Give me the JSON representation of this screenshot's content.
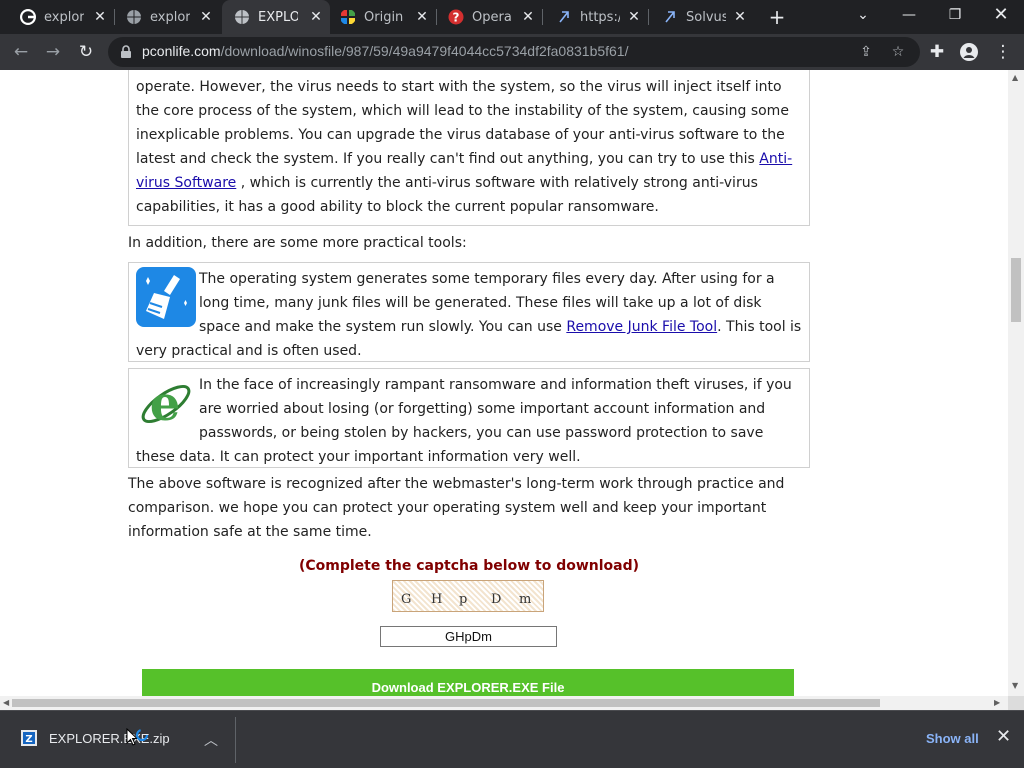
{
  "browser": {
    "tabs": [
      {
        "title": "explorer",
        "favicon": "google-icon",
        "active": false
      },
      {
        "title": "explorer",
        "favicon": "globe-icon",
        "active": false
      },
      {
        "title": "EXPLOR",
        "favicon": "globe-icon",
        "active": true
      },
      {
        "title": "Original",
        "favicon": "colorful-grid-icon",
        "active": false
      },
      {
        "title": "Operati",
        "favicon": "question-icon",
        "active": false
      },
      {
        "title": "https://",
        "favicon": "link-icon",
        "active": false
      },
      {
        "title": "Solvuso",
        "favicon": "link-icon",
        "active": false
      }
    ],
    "url_host": "pconlife.com",
    "url_path": "/download/winosfile/987/59/49a9479f4044cc5734df2fa0831b5f61/"
  },
  "page": {
    "box1_text_before_link": "operate. However, the virus needs to start with the system, so the virus will inject itself into the core process of the system, which will lead to the instability of the system, causing some inexplicable problems. You can upgrade the virus database of your anti-virus software to the latest and check the system. If you really can't find out anything, you can try to use this ",
    "box1_link": "Anti-virus Software",
    "box1_text_after_link": " , which is currently the anti-virus software with relatively strong anti-virus capabilities, it has a good ability to block the current popular ransomware.",
    "addition_text": "In addition, there are some more practical tools:",
    "box2_text_before_link": "The operating system generates some temporary files every day. After using for a long time, many junk files will be generated. These files will take up a lot of disk space and make the system run slowly. You can use ",
    "box2_link": "Remove Junk File Tool",
    "box2_text_after_link": ". This tool is very practical and is often used.",
    "box3_text": "In the face of increasingly rampant ransomware and information theft viruses, if you are worried about losing (or forgetting) some important account information and passwords, or being stolen by hackers, you can use password protection to save these data. It can protect your important information very well.",
    "summary_text": "The above software is recognized after the webmaster's long-term work through practice and comparison. we hope you can protect your operating system well and keep your important information safe at the same time.",
    "captcha_prompt": "(Complete the captcha below to download)",
    "captcha_chars": [
      "G",
      "H",
      "p",
      "D",
      "m"
    ],
    "captcha_value": "GHpDm",
    "download_button": "Download EXPLORER.EXE File"
  },
  "downloads": {
    "file_name": "EXPLORER.EXE.zip",
    "show_all": "Show all"
  },
  "colors": {
    "accent_link": "#1a0dab",
    "captcha_prompt": "#800000",
    "download_button": "#56c12a",
    "show_all": "#8ab4f8"
  }
}
